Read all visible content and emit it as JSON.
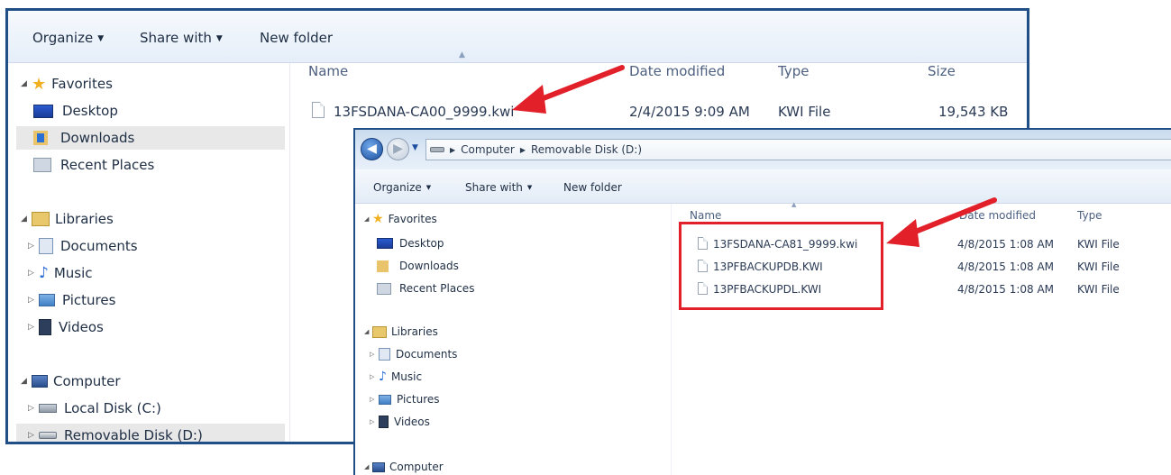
{
  "window1": {
    "toolbar": {
      "organize": "Organize",
      "share_with": "Share with",
      "new_folder": "New folder"
    },
    "nav": {
      "favorites": "Favorites",
      "desktop": "Desktop",
      "downloads": "Downloads",
      "recent_places": "Recent Places",
      "libraries": "Libraries",
      "documents": "Documents",
      "music": "Music",
      "pictures": "Pictures",
      "videos": "Videos",
      "computer": "Computer",
      "local_disk": "Local Disk (C:)",
      "removable_disk": "Removable Disk (D:)"
    },
    "columns": {
      "name": "Name",
      "date_modified": "Date modified",
      "type": "Type",
      "size": "Size"
    },
    "files": [
      {
        "name": "13FSDANA-CA00_9999.kwi",
        "date": "2/4/2015 9:09 AM",
        "type": "KWI File",
        "size": "19,543 KB"
      }
    ]
  },
  "window2": {
    "breadcrumb": {
      "computer": "Computer",
      "removable_disk": "Removable Disk (D:)"
    },
    "toolbar": {
      "organize": "Organize",
      "share_with": "Share with",
      "new_folder": "New folder"
    },
    "nav": {
      "favorites": "Favorites",
      "desktop": "Desktop",
      "downloads": "Downloads",
      "recent_places": "Recent Places",
      "libraries": "Libraries",
      "documents": "Documents",
      "music": "Music",
      "pictures": "Pictures",
      "videos": "Videos",
      "computer": "Computer"
    },
    "columns": {
      "name": "Name",
      "date_modified": "Date modified",
      "type": "Type"
    },
    "files": [
      {
        "name": "13FSDANA-CA81_9999.kwi",
        "date": "4/8/2015 1:08 AM",
        "type": "KWI File"
      },
      {
        "name": "13PFBACKUPDB.KWI",
        "date": "4/8/2015 1:08 AM",
        "type": "KWI File"
      },
      {
        "name": "13PFBACKUPDL.KWI",
        "date": "4/8/2015 1:08 AM",
        "type": "KWI File"
      }
    ]
  },
  "colors": {
    "window_border": "#1f4f86",
    "annotation_red": "#e2202a"
  },
  "icons": [
    "star-icon",
    "desktop-icon",
    "downloads-icon",
    "recent-places-icon",
    "libraries-icon",
    "documents-icon",
    "music-icon",
    "pictures-icon",
    "videos-icon",
    "computer-icon",
    "local-disk-icon",
    "removable-disk-icon",
    "file-icon",
    "back-icon",
    "forward-icon"
  ]
}
